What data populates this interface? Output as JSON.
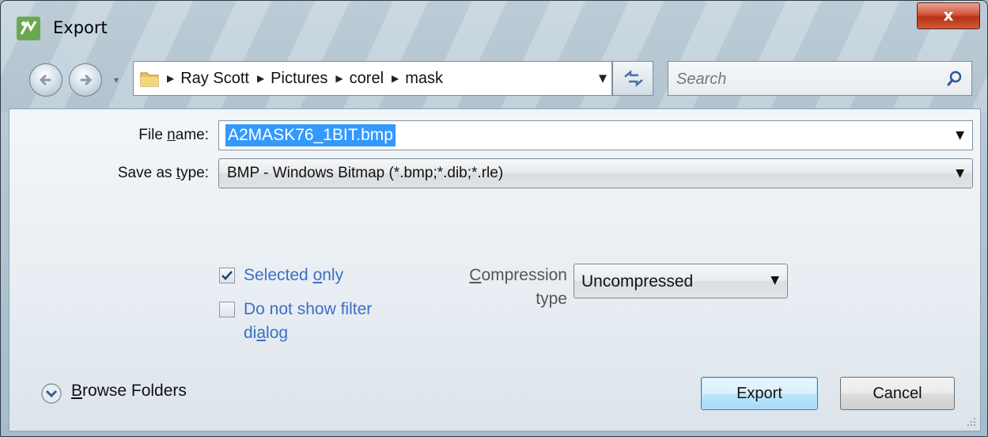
{
  "window": {
    "title": "Export",
    "close_glyph": "x"
  },
  "nav": {
    "history_arrow": "▾"
  },
  "address": {
    "crumbs": [
      {
        "label": "Ray Scott"
      },
      {
        "label": "Pictures"
      },
      {
        "label": "corel"
      },
      {
        "label": "mask"
      }
    ],
    "separator": "▶",
    "dropdown_arrow": "▼"
  },
  "search": {
    "placeholder": "Search"
  },
  "form": {
    "file_name_label_pre": "File ",
    "file_name_label_key": "n",
    "file_name_label_post": "ame:",
    "file_name_value": "A2MASK76_1BIT.bmp",
    "save_type_label_pre": "Save as ",
    "save_type_label_key": "t",
    "save_type_label_post": "ype:",
    "save_type_value": "BMP - Windows Bitmap (*.bmp;*.dib;*.rle)",
    "arrow": "▼"
  },
  "options": {
    "selected_only_pre": "Selected ",
    "selected_only_key": "o",
    "selected_only_post": "nly",
    "selected_only_checked": true,
    "no_filter_line1": "Do not show filter",
    "no_filter_line2_pre": "di",
    "no_filter_line2_key": "a",
    "no_filter_line2_post": "log",
    "no_filter_checked": false,
    "compression_label_key": "C",
    "compression_label_rest": "ompression",
    "compression_label_line2": "type",
    "compression_value": "Uncompressed"
  },
  "footer": {
    "browse_key": "B",
    "browse_rest": "rowse Folders",
    "export_label": "Export",
    "cancel_label": "Cancel"
  },
  "colors": {
    "accent_link": "#3b6fc6",
    "selection": "#3399ff",
    "close_button": "#c8462a"
  },
  "icons": [
    "app-icon",
    "back-arrow-icon",
    "forward-arrow-icon",
    "folder-icon",
    "refresh-icon",
    "search-icon",
    "checkmark-icon",
    "chevron-down-icon",
    "resize-grip-icon"
  ]
}
